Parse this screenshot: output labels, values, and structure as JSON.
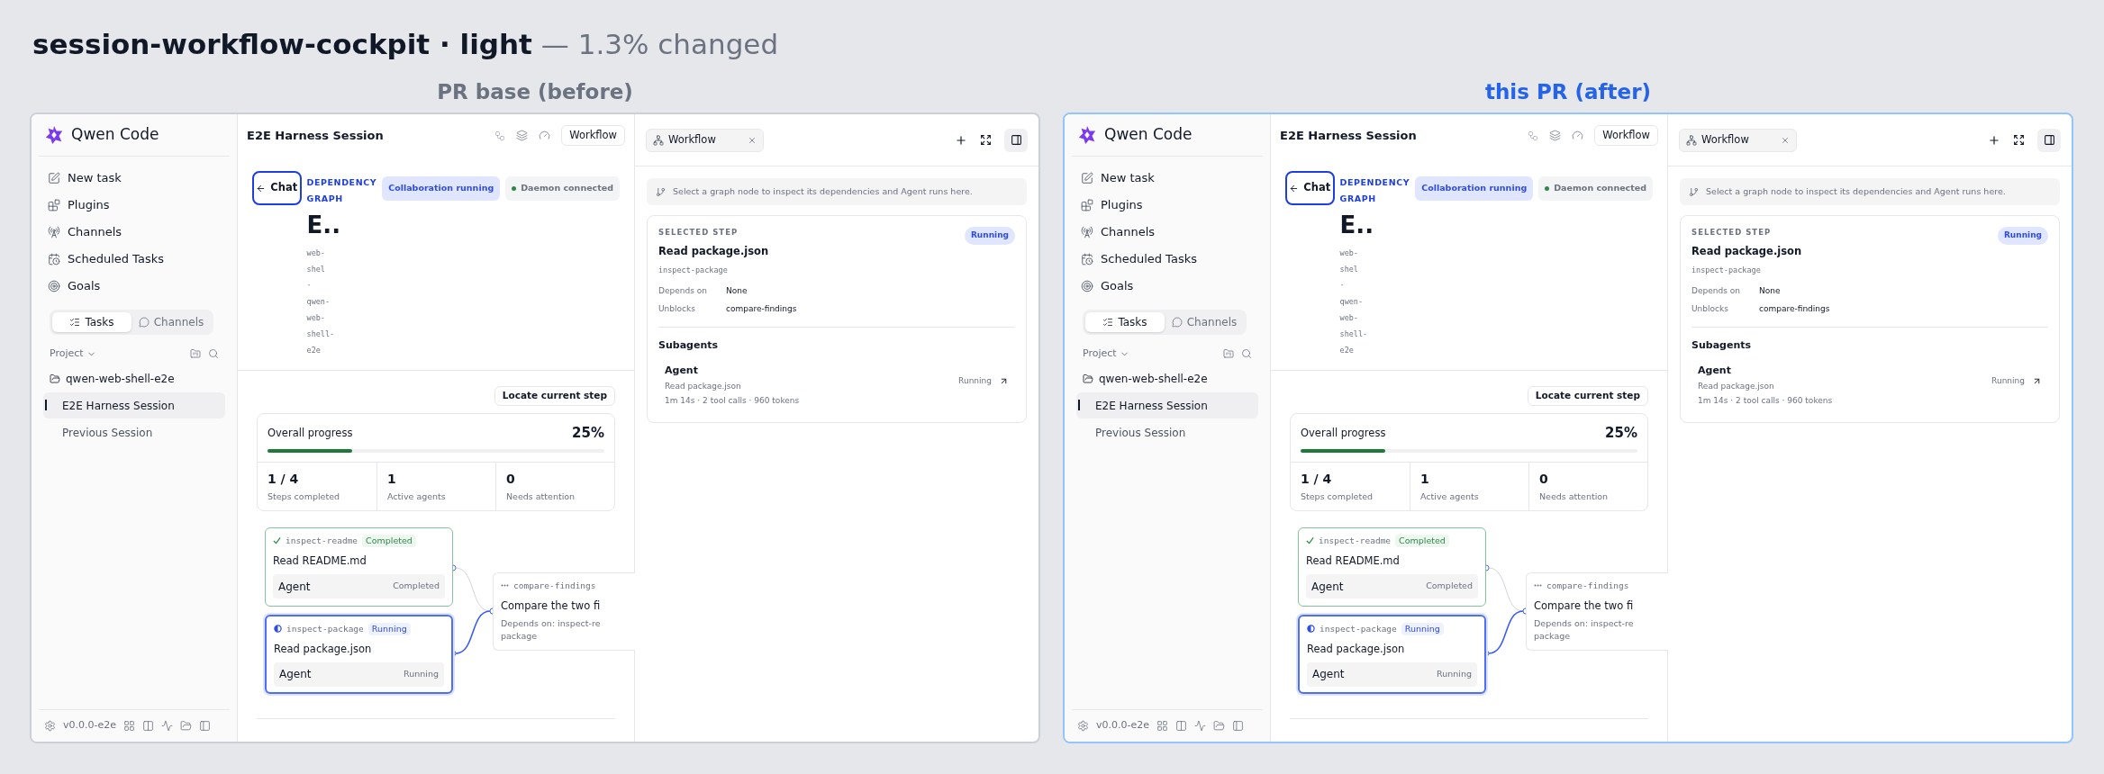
{
  "header": {
    "title": "session-workflow-cockpit · light",
    "subtitle": "— 1.3% changed"
  },
  "panels": [
    {
      "label": "PR base (before)",
      "emphasized": false,
      "sidebar": {
        "app_name": "Qwen Code",
        "nav": [
          {
            "label": "New task"
          },
          {
            "label": "Plugins"
          },
          {
            "label": "Channels"
          },
          {
            "label": "Scheduled Tasks"
          },
          {
            "label": "Goals"
          }
        ],
        "tabs": [
          {
            "label": "Tasks",
            "selected": true
          },
          {
            "label": "Channels",
            "selected": false
          }
        ],
        "project_label": "Project",
        "folder": "qwen-web-shell-e2e",
        "sessions": [
          {
            "label": "E2E Harness Session",
            "selected": true
          },
          {
            "label": "Previous Session",
            "selected": false
          }
        ],
        "version": "v0.0.0-e2e"
      },
      "main": {
        "title": "E2E Harness Session",
        "workflow_button": "Workflow",
        "back_button": "Chat",
        "eyebrow": "DEPENDENCY GRAPH",
        "badges": [
          {
            "label": "Collaboration running",
            "kind": "collab"
          },
          {
            "label": "Daemon connected",
            "kind": "daemon"
          }
        ],
        "heading": "E..",
        "path_lines": [
          "web-",
          "shel",
          "·",
          "qwen-",
          "web-",
          "shell-",
          "e2e"
        ],
        "locate_button": "Locate current step",
        "progress": {
          "label": "Overall progress",
          "percent": "25%",
          "level": 0.25,
          "stats": [
            {
              "value": "1 / 4",
              "label": "Steps completed"
            },
            {
              "value": "1",
              "label": "Active agents"
            },
            {
              "value": "0",
              "label": "Needs attention"
            }
          ]
        },
        "nodes": [
          {
            "slug": "inspect-readme",
            "status": "Completed",
            "kind": "completed",
            "title": "Read README.md",
            "agent": "Agent",
            "agent_status": "Completed"
          },
          {
            "slug": "inspect-package",
            "status": "Running",
            "kind": "running",
            "title": "Read package.json",
            "agent": "Agent",
            "agent_status": "Running"
          },
          {
            "slug": "compare-findings",
            "kind": "pending",
            "title": "Compare the two fi",
            "depends": [
              "Depends on: inspect-re",
              "package"
            ]
          }
        ]
      },
      "inspector": {
        "tab": "Workflow",
        "hint": "Select a graph node to inspect its dependencies and Agent runs here.",
        "section_label": "SELECTED STEP",
        "status": "Running",
        "title": "Read package.json",
        "step_slug": "inspect-package",
        "fields": [
          {
            "label": "Depends on",
            "value": "None"
          },
          {
            "label": "Unblocks",
            "value": "compare-findings"
          }
        ],
        "subagents_heading": "Subagents",
        "agent": {
          "name": "Agent",
          "task": "Read package.json",
          "meta": "1m 14s · 2 tool calls · 960 tokens",
          "status": "Running"
        }
      }
    },
    {
      "label": "this PR (after)",
      "emphasized": true,
      "sidebar": {
        "app_name": "Qwen Code",
        "nav": [
          {
            "label": "New task"
          },
          {
            "label": "Plugins"
          },
          {
            "label": "Channels"
          },
          {
            "label": "Scheduled Tasks"
          },
          {
            "label": "Goals"
          }
        ],
        "tabs": [
          {
            "label": "Tasks",
            "selected": true
          },
          {
            "label": "Channels",
            "selected": false
          }
        ],
        "project_label": "Project",
        "folder": "qwen-web-shell-e2e",
        "sessions": [
          {
            "label": "E2E Harness Session",
            "selected": true
          },
          {
            "label": "Previous Session",
            "selected": false
          }
        ],
        "version": "v0.0.0-e2e"
      },
      "main": {
        "title": "E2E Harness Session",
        "workflow_button": "Workflow",
        "back_button": "Chat",
        "eyebrow": "DEPENDENCY GRAPH",
        "badges": [
          {
            "label": "Collaboration running",
            "kind": "collab"
          },
          {
            "label": "Daemon connected",
            "kind": "daemon"
          }
        ],
        "heading": "E..",
        "path_lines": [
          "web-",
          "shel",
          "·",
          "qwen-",
          "web-",
          "shell-",
          "e2e"
        ],
        "locate_button": "Locate current step",
        "progress": {
          "label": "Overall progress",
          "percent": "25%",
          "level": 0.25,
          "stats": [
            {
              "value": "1 / 4",
              "label": "Steps completed"
            },
            {
              "value": "1",
              "label": "Active agents"
            },
            {
              "value": "0",
              "label": "Needs attention"
            }
          ]
        },
        "nodes": [
          {
            "slug": "inspect-readme",
            "status": "Completed",
            "kind": "completed",
            "title": "Read README.md",
            "agent": "Agent",
            "agent_status": "Completed"
          },
          {
            "slug": "inspect-package",
            "status": "Running",
            "kind": "running",
            "title": "Read package.json",
            "agent": "Agent",
            "agent_status": "Running"
          },
          {
            "slug": "compare-findings",
            "kind": "pending",
            "title": "Compare the two fi",
            "depends": [
              "Depends on: inspect-re",
              "package"
            ]
          }
        ]
      },
      "inspector": {
        "tab": "Workflow",
        "hint": "Select a graph node to inspect its dependencies and Agent runs here.",
        "section_label": "SELECTED STEP",
        "status": "Running",
        "title": "Read package.json",
        "step_slug": "inspect-package",
        "fields": [
          {
            "label": "Depends on",
            "value": "None"
          },
          {
            "label": "Unblocks",
            "value": "compare-findings"
          }
        ],
        "subagents_heading": "Subagents",
        "agent": {
          "name": "Agent",
          "task": "Read package.json",
          "meta": "1m 14s · 2 tool calls · 960 tokens",
          "status": "Running"
        }
      }
    }
  ]
}
